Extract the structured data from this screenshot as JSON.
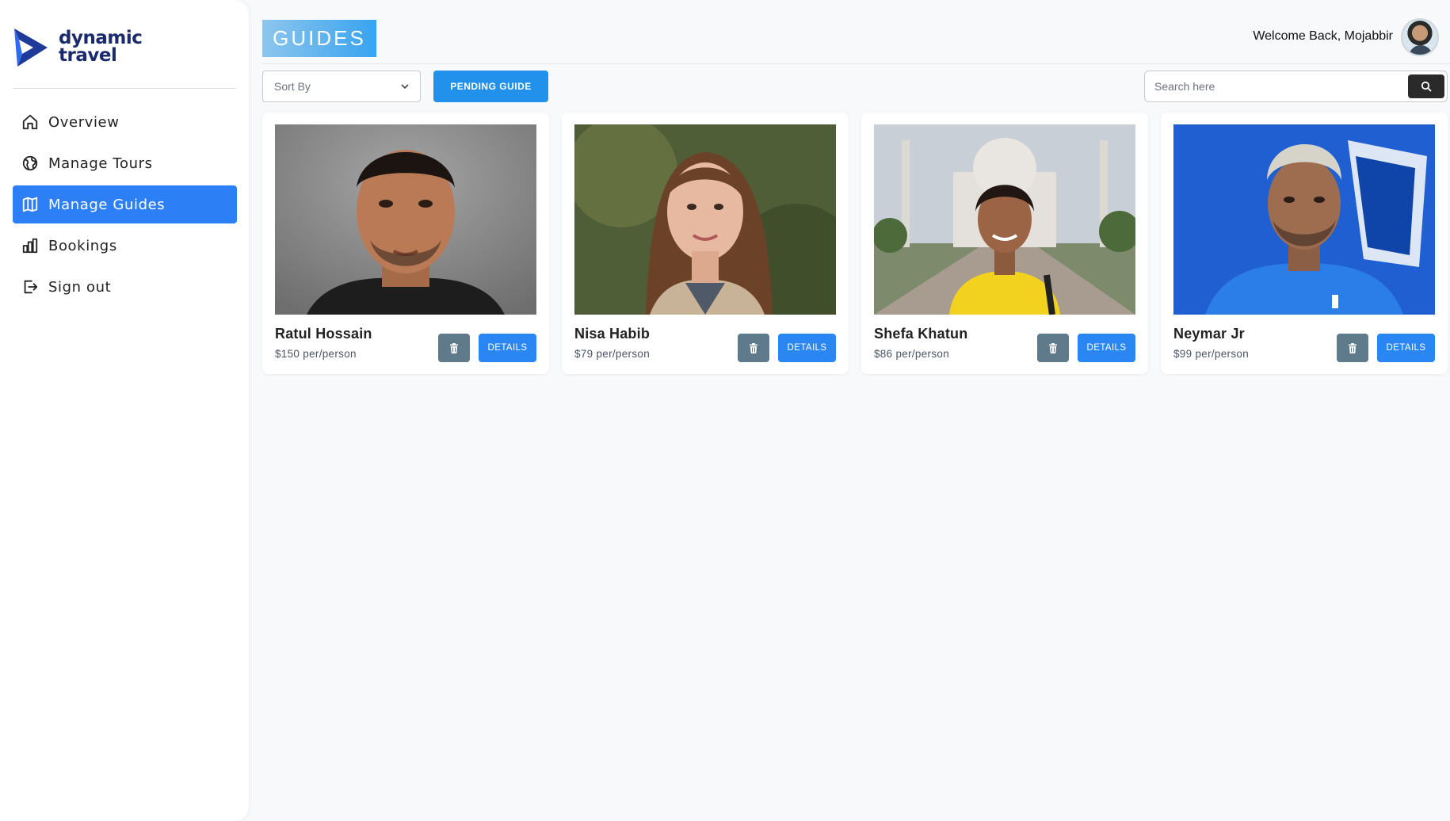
{
  "app": {
    "logo_text": "dynamic travel",
    "logo_line1": "dynamic",
    "logo_line2": "travel",
    "accent_color": "#2d7ff5"
  },
  "sidebar": {
    "items": [
      {
        "label": "Overview",
        "icon": "home-icon",
        "active": false
      },
      {
        "label": "Manage Tours",
        "icon": "globe-icon",
        "active": false
      },
      {
        "label": "Manage Guides",
        "icon": "map-icon",
        "active": true
      },
      {
        "label": "Bookings",
        "icon": "bar-chart-icon",
        "active": false
      },
      {
        "label": "Sign out",
        "icon": "logout-icon",
        "active": false
      }
    ]
  },
  "header": {
    "title": "GUIDES",
    "welcome": "Welcome Back, Mojabbir"
  },
  "toolbar": {
    "sort_label": "Sort By",
    "pending_label": "PENDING GUIDE",
    "search_placeholder": "Search here"
  },
  "guides": [
    {
      "name": "Ratul Hossain",
      "price": "$150 per/person",
      "details_label": "DETAILS"
    },
    {
      "name": "Nisa Habib",
      "price": "$79 per/person",
      "details_label": "DETAILS"
    },
    {
      "name": "Shefa Khatun",
      "price": "$86 per/person",
      "details_label": "DETAILS"
    },
    {
      "name": "Neymar Jr",
      "price": "$99 per/person",
      "details_label": "DETAILS"
    }
  ]
}
